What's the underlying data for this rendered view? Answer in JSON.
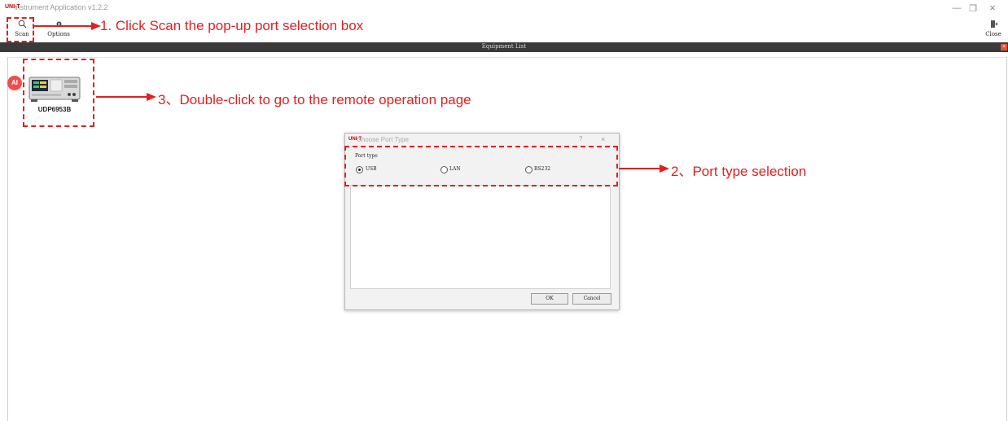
{
  "window": {
    "logo": "UNI-T",
    "title": "Instrument Application v1.2.2",
    "minimize_glyph": "—",
    "restore_glyph": "❐",
    "close_glyph": "×"
  },
  "toolbar": {
    "scan_label": "Scan",
    "options_label": "Options",
    "close_label": "Close",
    "scan_icon": "search-icon",
    "options_icon": "gear-icon",
    "close_icon": "exit-door-icon"
  },
  "equipment_list": {
    "title": "Equipment List",
    "close_glyph": "×",
    "ai_badge": "AI",
    "devices": [
      {
        "name": "UDP6953B"
      }
    ]
  },
  "dialog": {
    "logo": "UNI-T",
    "title": "Choose  Port Type",
    "help_glyph": "?",
    "close_glyph": "×",
    "port_type_label": "Port type",
    "port_options": [
      {
        "label": "USB",
        "selected": true
      },
      {
        "label": "LAN",
        "selected": false
      },
      {
        "label": "RS232",
        "selected": false
      }
    ],
    "ok_label": "OK",
    "cancel_label": "Cancel"
  },
  "annotations": {
    "step1": "1. Click Scan the pop-up port selection box",
    "step2": "2、Port type selection",
    "step3": "3、Double-click to go to the remote operation page"
  },
  "colors": {
    "annotation_red": "#e02020",
    "header_dark": "#3a3a3a",
    "brand_red": "#c00000"
  }
}
